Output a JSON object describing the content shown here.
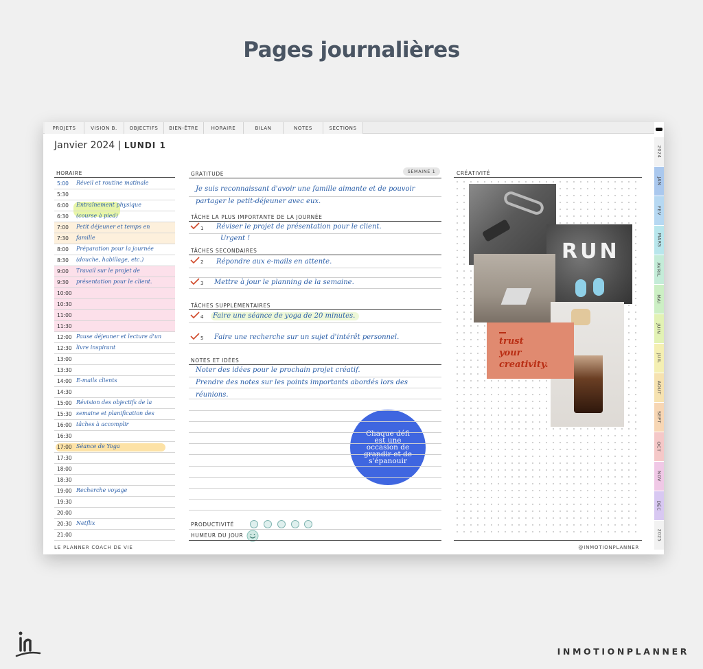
{
  "page": {
    "title": "Pages journalières",
    "brand": "INMOTIONPLANNER"
  },
  "tabs": [
    "PROJETS",
    "VISION B.",
    "OBJECTIFS",
    "BIEN-ÊTRE",
    "HORAIRE",
    "BILAN",
    "NOTES",
    "SECTIONS"
  ],
  "header": {
    "month_year": "Janvier 2024",
    "day": "LUNDI 1"
  },
  "schedule": {
    "title": "HORAIRE",
    "rows": [
      {
        "time": "5:00",
        "note": "Réveil et routine matinale"
      },
      {
        "time": "5:30",
        "note": ""
      },
      {
        "time": "6:00",
        "note": "Entraînement physique"
      },
      {
        "time": "6:30",
        "note": "(course à pied)"
      },
      {
        "time": "7:00",
        "note": "Petit déjeuner et temps en"
      },
      {
        "time": "7:30",
        "note": "famille"
      },
      {
        "time": "8:00",
        "note": "Préparation pour la journée"
      },
      {
        "time": "8:30",
        "note": "(douche, habillage, etc.)"
      },
      {
        "time": "9:00",
        "note": "Travail sur le projet de"
      },
      {
        "time": "9:30",
        "note": "présentation pour le client."
      },
      {
        "time": "10:00",
        "note": ""
      },
      {
        "time": "10:30",
        "note": ""
      },
      {
        "time": "11:00",
        "note": ""
      },
      {
        "time": "11:30",
        "note": ""
      },
      {
        "time": "12:00",
        "note": "Pause déjeuner et lecture d'un"
      },
      {
        "time": "12:30",
        "note": "livre inspirant"
      },
      {
        "time": "13:00",
        "note": ""
      },
      {
        "time": "13:30",
        "note": ""
      },
      {
        "time": "14:00",
        "note": "E-mails clients"
      },
      {
        "time": "14:30",
        "note": ""
      },
      {
        "time": "15:00",
        "note": "Révision des objectifs de la"
      },
      {
        "time": "15:30",
        "note": "semaine et planification des"
      },
      {
        "time": "16:00",
        "note": "tâches à accomplir"
      },
      {
        "time": "16:30",
        "note": ""
      },
      {
        "time": "17:00",
        "note": "Séance de Yoga"
      },
      {
        "time": "17:30",
        "note": ""
      },
      {
        "time": "18:00",
        "note": ""
      },
      {
        "time": "18:30",
        "note": ""
      },
      {
        "time": "19:00",
        "note": "Recherche voyage"
      },
      {
        "time": "19:30",
        "note": ""
      },
      {
        "time": "20:00",
        "note": ""
      },
      {
        "time": "20:30",
        "note": "Netflix"
      },
      {
        "time": "21:00",
        "note": ""
      }
    ]
  },
  "gratitude": {
    "title": "GRATITUDE",
    "week_badge": "SEMAINE 1",
    "line1": "Je suis reconnaissant d'avoir une famille aimante et de pouvoir",
    "line2": "partager le petit-déjeuner avec eux."
  },
  "main_task": {
    "title": "TÂCHE LA PLUS IMPORTANTE DE LA JOURNÉE",
    "num": "1",
    "line1": "Réviser le projet de présentation pour le client.",
    "line2": "Urgent !"
  },
  "secondary": {
    "title": "TÂCHES SECONDAIRES",
    "items": [
      {
        "num": "2",
        "text": "Répondre aux e-mails en attente."
      },
      {
        "num": "3",
        "text": "Mettre à jour le planning de la semaine."
      }
    ]
  },
  "extra": {
    "title": "TÂCHES SUPPLÉMENTAIRES",
    "items": [
      {
        "num": "4",
        "text": "Faire une séance de yoga de 20 minutes."
      },
      {
        "num": "5",
        "text": "Faire une recherche sur un sujet d'intérêt personnel."
      }
    ]
  },
  "notes": {
    "title": "NOTES ET IDÉES",
    "line1": "Noter des idées pour le prochain projet créatif.",
    "line2": "Prendre des notes sur les points importants abordés lors des",
    "line3": "réunions."
  },
  "quote": "Chaque défi est une occasion de grandir et de s'épanouir",
  "productivity_label": "PRODUCTIVITÉ",
  "mood_label": "HUMEUR DU JOUR",
  "creativity": {
    "title": "CRÉATIVITÉ",
    "run_text": "RUN",
    "trust_line1": "trust",
    "trust_line2": "your",
    "trust_line3": "creativity."
  },
  "side_tabs": [
    "2024",
    "JAN",
    "FEV",
    "MARS",
    "AVRIL",
    "MAI",
    "JUIN",
    "JUIL",
    "AOUT",
    "SEPT",
    "OCT",
    "NOV",
    "DÉC",
    "2025"
  ],
  "footer": {
    "left": "LE PLANNER COACH DE VIE",
    "right": "@INMOTIONPLANNER"
  }
}
